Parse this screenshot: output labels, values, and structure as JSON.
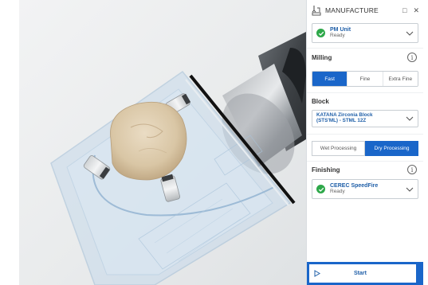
{
  "window": {
    "title": "MANUFACTURE",
    "maximize_glyph": "□",
    "close_glyph": "✕"
  },
  "device": {
    "name": "PM Unit",
    "status": "Ready"
  },
  "milling": {
    "label": "Milling",
    "info_glyph": "i",
    "options": [
      "Fast",
      "Fine",
      "Extra Fine"
    ],
    "selected": "Fast"
  },
  "block": {
    "label": "Block",
    "line1": "KATANA Zirconia Block",
    "line2": "(STS'ML) - STML 12Z"
  },
  "processing": {
    "options": [
      "Wet Processing",
      "Dry Processing"
    ],
    "selected": "Dry Processing"
  },
  "finishing": {
    "label": "Finishing",
    "info_glyph": "i",
    "device_name": "CEREC SpeedFire",
    "device_status": "Ready"
  },
  "start": {
    "label": "Start"
  },
  "colors": {
    "accent": "#1a66c9",
    "ready_green": "#2ea84a",
    "link_blue": "#1f5fa8"
  },
  "icons": [
    "manufacture-icon",
    "maximize-icon",
    "close-icon",
    "check-icon",
    "chevron-down-icon",
    "info-icon",
    "play-icon"
  ]
}
